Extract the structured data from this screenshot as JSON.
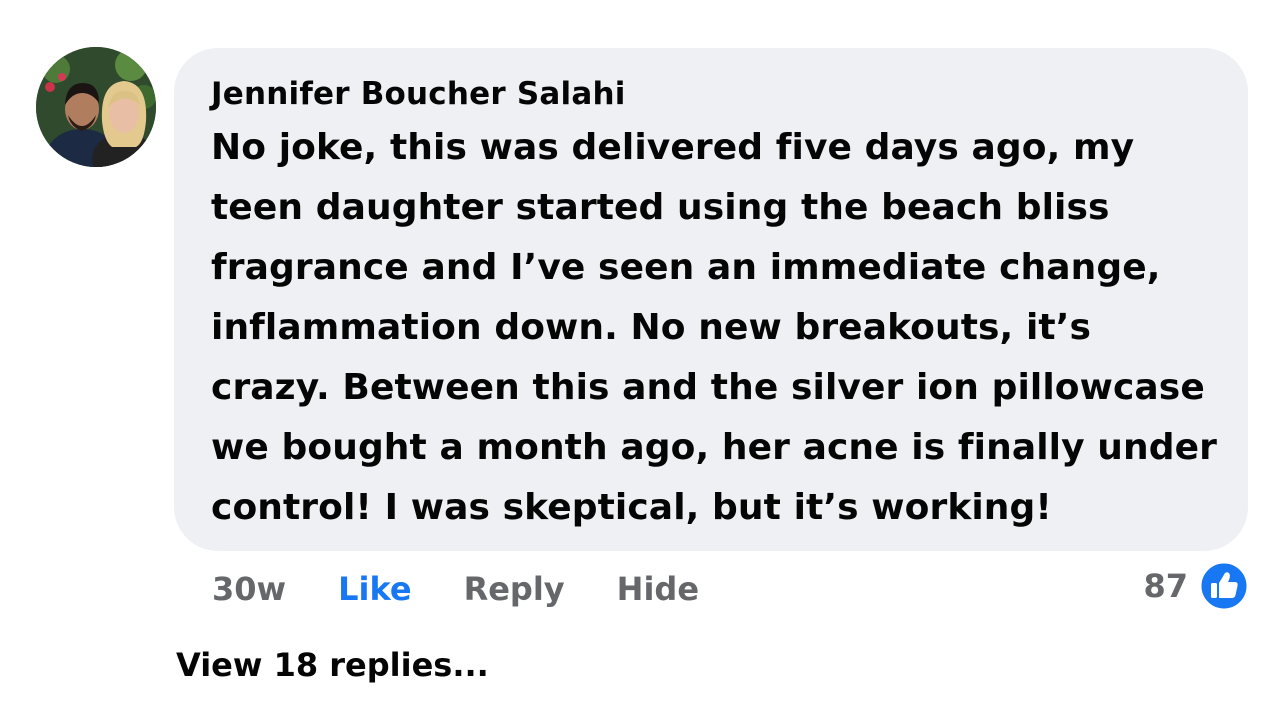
{
  "comment": {
    "author": "Jennifer Boucher Salahi",
    "text": "No joke, this was delivered five days ago, my teen daughter started using the beach bliss fragrance and I’ve seen an immediate change, inflammation down. No new breakouts, it’s crazy. Between this and the silver ion pillowcase we bought a month ago, her acne is finally under control! I was skeptical, but it’s working!",
    "timestamp": "30w",
    "actions": {
      "like": "Like",
      "reply": "Reply",
      "hide": "Hide"
    },
    "reaction_count": "87",
    "reaction_icon": "thumbs-up-icon",
    "view_replies": "View 18 replies..."
  },
  "colors": {
    "bubble": "#eff0f4",
    "like_accent": "#1877f2",
    "secondary_text": "#65676b",
    "primary_text": "#050505"
  }
}
